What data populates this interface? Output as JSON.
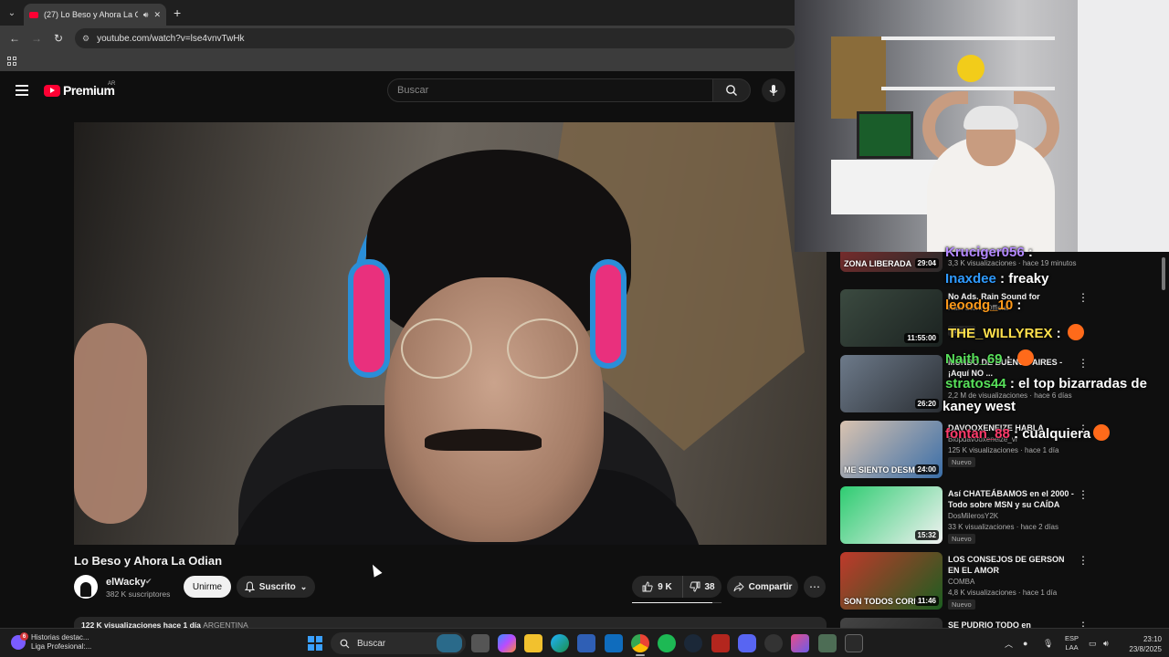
{
  "browser": {
    "tab_title": "(27) Lo Beso y Ahora La Odi",
    "url": "youtube.com/watch?v=lse4vnvTwHk"
  },
  "youtube": {
    "logo_text": "Premium",
    "country_code": "AR",
    "search_placeholder": "Buscar"
  },
  "video": {
    "title": "Lo Beso y Ahora La Odian",
    "channel": "elWacky",
    "subscribers": "382 K suscriptores",
    "join_label": "Unirme",
    "subscribed_label": "Suscrito",
    "likes": "9 K",
    "dislikes": "38",
    "share_label": "Compartir",
    "views_line": "122 K visualizaciones  hace 1 día",
    "country_tag": "ARGENTINA"
  },
  "recommendations": [
    {
      "thumb_text": "ZONA LIBERADA",
      "duration": "29:04",
      "title": "",
      "channel": "",
      "meta": "3,3 K visualizaciones · hace 19 minutos",
      "badge": "",
      "colors": [
        "#8a2b2b",
        "#2b2b2b"
      ]
    },
    {
      "thumb_text": "",
      "duration": "11:55:00",
      "title": "No Ads. Rain Sound for",
      "channel": "Rain Storm Official",
      "meta": "",
      "badge": "Nuevo",
      "colors": [
        "#3b4a40",
        "#1b2220"
      ]
    },
    {
      "thumb_text": "",
      "duration": "26:20",
      "title": "MUNDO DE BUENOS AIRES - ¡Aquí NO ...",
      "channel": "",
      "meta": "2,2 M de visualizaciones · hace 6 días",
      "badge": "",
      "colors": [
        "#6d7a8a",
        "#2a2e33"
      ]
    },
    {
      "thumb_text": "ME SIENTO DESMOT",
      "duration": "24:00",
      "title": "DAVOOXENEIZE HABLA",
      "channel": "Blopdavooxeneize_vr",
      "meta": "125 K visualizaciones · hace 1 día",
      "badge": "Nuevo",
      "colors": [
        "#d9c3b0",
        "#3a6ea8"
      ]
    },
    {
      "thumb_text": "",
      "duration": "15:32",
      "title": "Así CHATEÁBAMOS en el 2000 - Todo sobre MSN y su CAÍDA",
      "channel": "DosMilerosY2K",
      "meta": "33 K visualizaciones · hace 2 días",
      "badge": "Nuevo",
      "colors": [
        "#2ecc71",
        "#f2f2f2"
      ]
    },
    {
      "thumb_text": "SON TODOS CORNI",
      "duration": "11:46",
      "title": "LOS CONSEJOS DE GERSON EN EL AMOR",
      "channel": "COMBA",
      "meta": "4,8 K visualizaciones · hace 1 día",
      "badge": "Nuevo",
      "colors": [
        "#c0392b",
        "#1b5e20"
      ]
    },
    {
      "thumb_text": "",
      "duration": "",
      "title": "SE PUDRIO TODO en",
      "channel": "",
      "meta": "",
      "badge": "",
      "colors": [
        "#444",
        "#222"
      ]
    }
  ],
  "chat": [
    {
      "user": "Kruciger056",
      "sep": " : ",
      "msg": "",
      "color": "#b388ff",
      "emote": false
    },
    {
      "user": "Inaxdee",
      "sep": " : ",
      "msg": "freaky",
      "color": "#2f9bff",
      "emote": false
    },
    {
      "user": "leoodg_10",
      "sep": " : ",
      "msg": "",
      "color": "#ff9a1a",
      "emote": false
    },
    {
      "user": "THE_WILLYREX",
      "sep": " : ",
      "msg": "",
      "color": "#ffe14d",
      "emote": true
    },
    {
      "user": "Naith_69",
      "sep": " : ",
      "msg": "",
      "color": "#58e05a",
      "emote": true
    },
    {
      "user": "stratos44",
      "sep": " : ",
      "msg": "el top bizarradas de",
      "color": "#58e05a",
      "emote": false
    },
    {
      "user": "",
      "sep": "",
      "msg": "kaney west",
      "color": "#ffffff",
      "emote": false
    },
    {
      "user": "fontan_88",
      "sep": " : ",
      "msg": "cualquiera",
      "color": "#ff3b6b",
      "emote": true
    }
  ],
  "taskbar": {
    "news_title": "Historias destac...",
    "news_sub": "Liga Profesional:...",
    "news_badge": "6",
    "search_label": "Buscar",
    "lang_1": "ESP",
    "lang_2": "LAA",
    "time": "23:10",
    "date": "23/8/2025"
  }
}
